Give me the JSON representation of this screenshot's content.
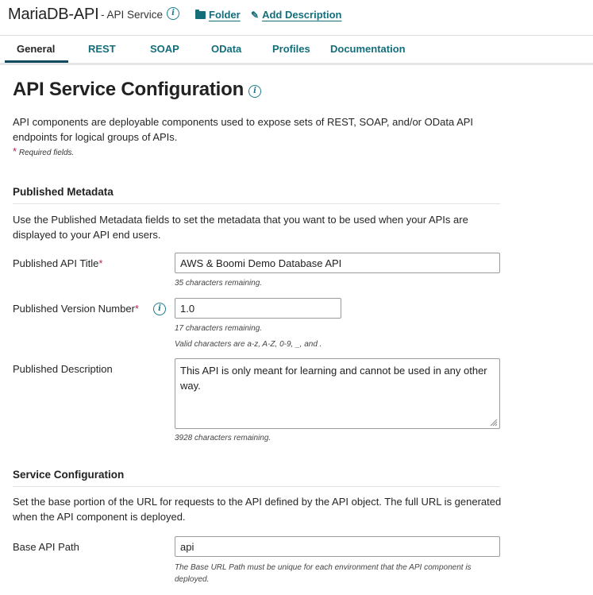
{
  "header": {
    "title": "MariaDB-API",
    "subtitle": "- API Service",
    "info_icon": "info-icon",
    "folder_link": "Folder",
    "folder_icon": "folder-icon",
    "add_description_link": "Add Description",
    "pencil_icon": "pencil-icon"
  },
  "tabs": [
    {
      "label": "General",
      "active": true
    },
    {
      "label": "REST",
      "active": false
    },
    {
      "label": "SOAP",
      "active": false
    },
    {
      "label": "OData",
      "active": false
    },
    {
      "label": "Profiles",
      "active": false
    },
    {
      "label": "Documentation",
      "active": false
    }
  ],
  "main": {
    "title": "API Service Configuration",
    "intro": "API components are deployable components used to expose sets of REST, SOAP, and/or OData API endpoints for logical groups of APIs.",
    "required_star": "*",
    "required_note": "Required fields."
  },
  "published_metadata": {
    "heading": "Published Metadata",
    "description": "Use the Published Metadata fields to set the metadata that you want to be used when your APIs are displayed to your API end users.",
    "api_title": {
      "label": "Published API Title",
      "required_star": "*",
      "value": "AWS & Boomi Demo Database API",
      "hint": "35 characters remaining."
    },
    "version_number": {
      "label": "Published Version Number",
      "required_star": "*",
      "value": "1.0",
      "hint": "17 characters remaining.",
      "hint2": "Valid characters are a-z, A-Z, 0-9, _, and ."
    },
    "description_field": {
      "label": "Published Description",
      "value": "This API is only meant for learning and cannot be used in any other way.",
      "hint": "3928 characters remaining."
    }
  },
  "service_configuration": {
    "heading": "Service Configuration",
    "description": "Set the base portion of the URL for requests to the API defined by the API object. The full URL is generated when the API component is deployed.",
    "base_path": {
      "label": "Base API Path",
      "value": "api",
      "hint": "The Base URL Path must be unique for each environment that the API component is deployed."
    }
  },
  "colors": {
    "accent": "#146e7a",
    "required": "#b0284a",
    "active_tab_underline": "#0d4a5e"
  }
}
